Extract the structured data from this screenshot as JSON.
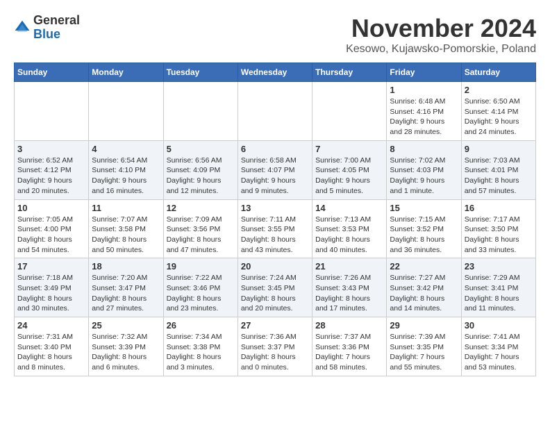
{
  "logo": {
    "general": "General",
    "blue": "Blue"
  },
  "title": "November 2024",
  "location": "Kesowo, Kujawsko-Pomorskie, Poland",
  "days_of_week": [
    "Sunday",
    "Monday",
    "Tuesday",
    "Wednesday",
    "Thursday",
    "Friday",
    "Saturday"
  ],
  "weeks": [
    [
      {
        "day": "",
        "info": ""
      },
      {
        "day": "",
        "info": ""
      },
      {
        "day": "",
        "info": ""
      },
      {
        "day": "",
        "info": ""
      },
      {
        "day": "",
        "info": ""
      },
      {
        "day": "1",
        "info": "Sunrise: 6:48 AM\nSunset: 4:16 PM\nDaylight: 9 hours and 28 minutes."
      },
      {
        "day": "2",
        "info": "Sunrise: 6:50 AM\nSunset: 4:14 PM\nDaylight: 9 hours and 24 minutes."
      }
    ],
    [
      {
        "day": "3",
        "info": "Sunrise: 6:52 AM\nSunset: 4:12 PM\nDaylight: 9 hours and 20 minutes."
      },
      {
        "day": "4",
        "info": "Sunrise: 6:54 AM\nSunset: 4:10 PM\nDaylight: 9 hours and 16 minutes."
      },
      {
        "day": "5",
        "info": "Sunrise: 6:56 AM\nSunset: 4:09 PM\nDaylight: 9 hours and 12 minutes."
      },
      {
        "day": "6",
        "info": "Sunrise: 6:58 AM\nSunset: 4:07 PM\nDaylight: 9 hours and 9 minutes."
      },
      {
        "day": "7",
        "info": "Sunrise: 7:00 AM\nSunset: 4:05 PM\nDaylight: 9 hours and 5 minutes."
      },
      {
        "day": "8",
        "info": "Sunrise: 7:02 AM\nSunset: 4:03 PM\nDaylight: 9 hours and 1 minute."
      },
      {
        "day": "9",
        "info": "Sunrise: 7:03 AM\nSunset: 4:01 PM\nDaylight: 8 hours and 57 minutes."
      }
    ],
    [
      {
        "day": "10",
        "info": "Sunrise: 7:05 AM\nSunset: 4:00 PM\nDaylight: 8 hours and 54 minutes."
      },
      {
        "day": "11",
        "info": "Sunrise: 7:07 AM\nSunset: 3:58 PM\nDaylight: 8 hours and 50 minutes."
      },
      {
        "day": "12",
        "info": "Sunrise: 7:09 AM\nSunset: 3:56 PM\nDaylight: 8 hours and 47 minutes."
      },
      {
        "day": "13",
        "info": "Sunrise: 7:11 AM\nSunset: 3:55 PM\nDaylight: 8 hours and 43 minutes."
      },
      {
        "day": "14",
        "info": "Sunrise: 7:13 AM\nSunset: 3:53 PM\nDaylight: 8 hours and 40 minutes."
      },
      {
        "day": "15",
        "info": "Sunrise: 7:15 AM\nSunset: 3:52 PM\nDaylight: 8 hours and 36 minutes."
      },
      {
        "day": "16",
        "info": "Sunrise: 7:17 AM\nSunset: 3:50 PM\nDaylight: 8 hours and 33 minutes."
      }
    ],
    [
      {
        "day": "17",
        "info": "Sunrise: 7:18 AM\nSunset: 3:49 PM\nDaylight: 8 hours and 30 minutes."
      },
      {
        "day": "18",
        "info": "Sunrise: 7:20 AM\nSunset: 3:47 PM\nDaylight: 8 hours and 27 minutes."
      },
      {
        "day": "19",
        "info": "Sunrise: 7:22 AM\nSunset: 3:46 PM\nDaylight: 8 hours and 23 minutes."
      },
      {
        "day": "20",
        "info": "Sunrise: 7:24 AM\nSunset: 3:45 PM\nDaylight: 8 hours and 20 minutes."
      },
      {
        "day": "21",
        "info": "Sunrise: 7:26 AM\nSunset: 3:43 PM\nDaylight: 8 hours and 17 minutes."
      },
      {
        "day": "22",
        "info": "Sunrise: 7:27 AM\nSunset: 3:42 PM\nDaylight: 8 hours and 14 minutes."
      },
      {
        "day": "23",
        "info": "Sunrise: 7:29 AM\nSunset: 3:41 PM\nDaylight: 8 hours and 11 minutes."
      }
    ],
    [
      {
        "day": "24",
        "info": "Sunrise: 7:31 AM\nSunset: 3:40 PM\nDaylight: 8 hours and 8 minutes."
      },
      {
        "day": "25",
        "info": "Sunrise: 7:32 AM\nSunset: 3:39 PM\nDaylight: 8 hours and 6 minutes."
      },
      {
        "day": "26",
        "info": "Sunrise: 7:34 AM\nSunset: 3:38 PM\nDaylight: 8 hours and 3 minutes."
      },
      {
        "day": "27",
        "info": "Sunrise: 7:36 AM\nSunset: 3:37 PM\nDaylight: 8 hours and 0 minutes."
      },
      {
        "day": "28",
        "info": "Sunrise: 7:37 AM\nSunset: 3:36 PM\nDaylight: 7 hours and 58 minutes."
      },
      {
        "day": "29",
        "info": "Sunrise: 7:39 AM\nSunset: 3:35 PM\nDaylight: 7 hours and 55 minutes."
      },
      {
        "day": "30",
        "info": "Sunrise: 7:41 AM\nSunset: 3:34 PM\nDaylight: 7 hours and 53 minutes."
      }
    ]
  ]
}
